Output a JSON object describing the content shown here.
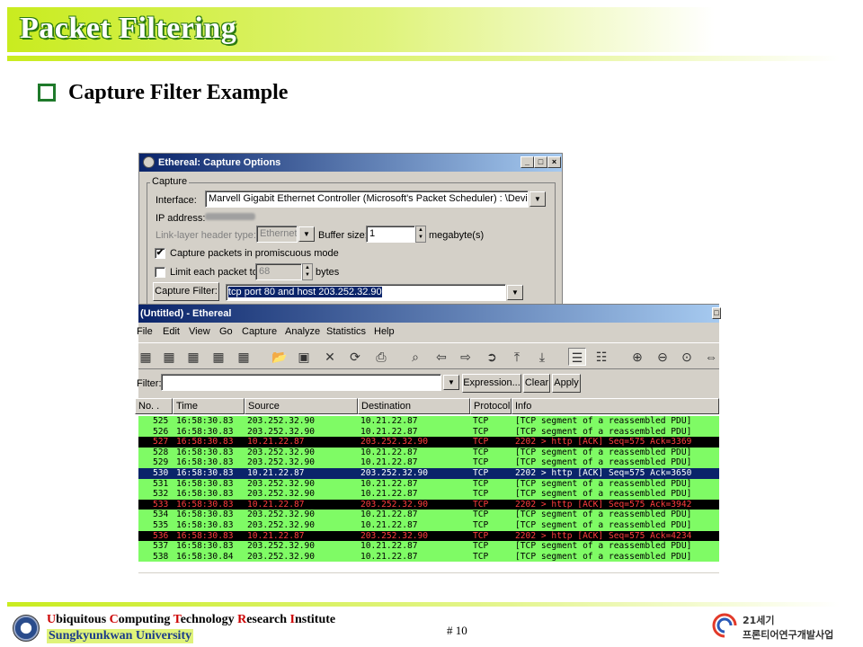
{
  "slide": {
    "title": "Packet Filtering",
    "bullet": "Capture Filter Example",
    "page": "# 10",
    "footer_univ": "Sungkyunkwan University",
    "footer_inst": [
      {
        "cap": "U",
        "rest": "biquitous "
      },
      {
        "cap": "C",
        "rest": "omputing "
      },
      {
        "cap": "T",
        "rest": "echnology "
      },
      {
        "cap": "R",
        "rest": "esearch "
      },
      {
        "cap": "I",
        "rest": "nstitute"
      }
    ],
    "brand_line1": "21세기",
    "brand_line2": "프론티어연구개발사업"
  },
  "capture_options": {
    "title": "Ethereal: Capture Options",
    "group": "Capture",
    "interface_label": "Interface:",
    "interface_value": "Marvell Gigabit Ethernet Controller (Microsoft's Packet Scheduler) : \\Device\\NPF",
    "ip_label": "IP address:",
    "link_label": "Link-layer header type:",
    "link_value": "Ethernet",
    "buffer_label": "Buffer size:",
    "buffer_value": "1",
    "buffer_unit": "megabyte(s)",
    "promisc_label": "Capture packets in promiscuous mode",
    "promisc_checked": true,
    "limit_label": "Limit each packet to",
    "limit_value": "68",
    "limit_unit": "bytes",
    "limit_checked": false,
    "filter_button": "Capture Filter:",
    "filter_value": "tcp port 80 and host 203.252.32.90"
  },
  "main": {
    "title": "(Untitled) - Ethereal",
    "menus": [
      "File",
      "Edit",
      "View",
      "Go",
      "Capture",
      "Analyze",
      "Statistics",
      "Help"
    ],
    "filter_label": "Filter:",
    "filter_value": "",
    "expression_btn": "Expression...",
    "clear_btn": "Clear",
    "apply_btn": "Apply",
    "columns": [
      "No. .",
      "Time",
      "Source",
      "Destination",
      "Protocol",
      "Info"
    ],
    "packets": [
      {
        "no": "525",
        "time": "16:58:30.83",
        "src": "203.252.32.90",
        "dst": "10.21.22.87",
        "proto": "TCP",
        "info": "[TCP segment of a reassembled PDU]",
        "style": "green"
      },
      {
        "no": "526",
        "time": "16:58:30.83",
        "src": "203.252.32.90",
        "dst": "10.21.22.87",
        "proto": "TCP",
        "info": "[TCP segment of a reassembled PDU]",
        "style": "green"
      },
      {
        "no": "527",
        "time": "16:58:30.83",
        "src": "10.21.22.87",
        "dst": "203.252.32.90",
        "proto": "TCP",
        "info": "2202 > http [ACK] Seq=575 Ack=3369",
        "style": "black"
      },
      {
        "no": "528",
        "time": "16:58:30.83",
        "src": "203.252.32.90",
        "dst": "10.21.22.87",
        "proto": "TCP",
        "info": "[TCP segment of a reassembled PDU]",
        "style": "green"
      },
      {
        "no": "529",
        "time": "16:58:30.83",
        "src": "203.252.32.90",
        "dst": "10.21.22.87",
        "proto": "TCP",
        "info": "[TCP segment of a reassembled PDU]",
        "style": "green"
      },
      {
        "no": "530",
        "time": "16:58:30.83",
        "src": "10.21.22.87",
        "dst": "203.252.32.90",
        "proto": "TCP",
        "info": "2202 > http [ACK] Seq=575 Ack=3650",
        "style": "sel"
      },
      {
        "no": "531",
        "time": "16:58:30.83",
        "src": "203.252.32.90",
        "dst": "10.21.22.87",
        "proto": "TCP",
        "info": "[TCP segment of a reassembled PDU]",
        "style": "green"
      },
      {
        "no": "532",
        "time": "16:58:30.83",
        "src": "203.252.32.90",
        "dst": "10.21.22.87",
        "proto": "TCP",
        "info": "[TCP segment of a reassembled PDU]",
        "style": "green"
      },
      {
        "no": "533",
        "time": "16:58:30.83",
        "src": "10.21.22.87",
        "dst": "203.252.32.90",
        "proto": "TCP",
        "info": "2202 > http [ACK] Seq=575 Ack=3942",
        "style": "black"
      },
      {
        "no": "534",
        "time": "16:58:30.83",
        "src": "203.252.32.90",
        "dst": "10.21.22.87",
        "proto": "TCP",
        "info": "[TCP segment of a reassembled PDU]",
        "style": "green"
      },
      {
        "no": "535",
        "time": "16:58:30.83",
        "src": "203.252.32.90",
        "dst": "10.21.22.87",
        "proto": "TCP",
        "info": "[TCP segment of a reassembled PDU]",
        "style": "green"
      },
      {
        "no": "536",
        "time": "16:58:30.83",
        "src": "10.21.22.87",
        "dst": "203.252.32.90",
        "proto": "TCP",
        "info": "2202 > http [ACK] Seq=575 Ack=4234",
        "style": "black"
      },
      {
        "no": "537",
        "time": "16:58:30.83",
        "src": "203.252.32.90",
        "dst": "10.21.22.87",
        "proto": "TCP",
        "info": "[TCP segment of a reassembled PDU]",
        "style": "green"
      },
      {
        "no": "538",
        "time": "16:58:30.84",
        "src": "203.252.32.90",
        "dst": "10.21.22.87",
        "proto": "TCP",
        "info": "[TCP segment of a reassembled PDU]",
        "style": "green"
      }
    ]
  }
}
